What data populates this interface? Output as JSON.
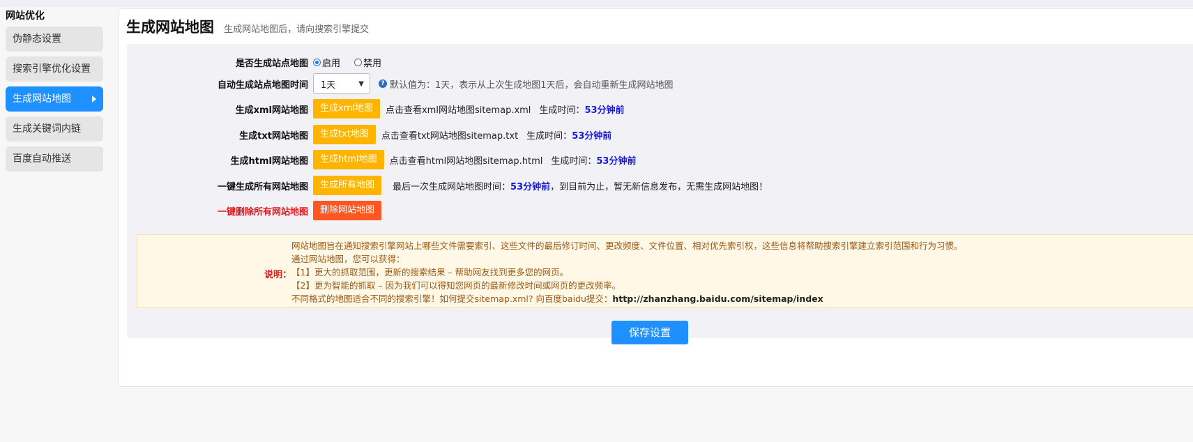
{
  "sidebar": {
    "title": "网站优化",
    "items": [
      {
        "label": "伪静态设置"
      },
      {
        "label": "搜索引擎优化设置"
      },
      {
        "label": "生成网站地图"
      },
      {
        "label": "生成关键词内链"
      },
      {
        "label": "百度自动推送"
      }
    ],
    "active_index": 2
  },
  "page": {
    "title": "生成网站地图",
    "subtitle": "生成网站地图后，请向搜索引擎提交"
  },
  "form": {
    "enable_row": {
      "label": "是否生成站点地图",
      "opt_on": "启用",
      "opt_off": "禁用",
      "selected": "启用"
    },
    "auto_row": {
      "label": "自动生成站点地图时间",
      "select_value": "1天",
      "hint": "默认值为：1天，表示从上次生成地图1天后，会自动重新生成网站地图"
    },
    "xml_row": {
      "label": "生成xml网站地图",
      "button": "生成xml地图",
      "link": "点击查看xml网站地图sitemap.xml",
      "time_label": "生成时间：",
      "time": "53分钟前"
    },
    "txt_row": {
      "label": "生成txt网站地图",
      "button": "生成txt地图",
      "link": "点击查看txt网站地图sitemap.txt",
      "time_label": "生成时间：",
      "time": "53分钟前"
    },
    "html_row": {
      "label": "生成html网站地图",
      "button": "生成html地图",
      "link": "点击查看html网站地图sitemap.html",
      "time_label": "生成时间：",
      "time": "53分钟前"
    },
    "all_row": {
      "label": "一键生成所有网站地图",
      "button": "生成所有地图",
      "prefix": "最后一次生成网站地图时间：",
      "time": "53分钟前",
      "suffix": "，到目前为止，暂无新信息发布，无需生成网站地图！"
    },
    "delete_row": {
      "label": "一键删除所有网站地图",
      "button": "删除网站地图"
    }
  },
  "note": {
    "label": "说明：",
    "lines": [
      "网站地图旨在通知搜索引擎网站上哪些文件需要索引、这些文件的最后修订时间、更改频度、文件位置、相对优先索引权，这些信息将帮助搜索引擎建立索引范围和行为习惯。",
      "通过网站地图，您可以获得：",
      "【1】更大的抓取范围，更新的搜索结果 – 帮助网友找到更多您的网页。",
      "【2】更为智能的抓取 – 因为我们可以得知您网页的最新修改时间或网页的更改频率。"
    ],
    "last_prefix": "不同格式的地图适合不同的搜索引擎！如何提交sitemap.xml? 向百度baidu提交：",
    "last_url": "http://zhanzhang.baidu.com/sitemap/index"
  },
  "save_button": "保存设置",
  "colors": {
    "accent": "#1e90ff",
    "yellow_button": "#ffb400",
    "red_button": "#ff5722",
    "time_text": "#1818d8",
    "danger_label": "#e5161a"
  }
}
